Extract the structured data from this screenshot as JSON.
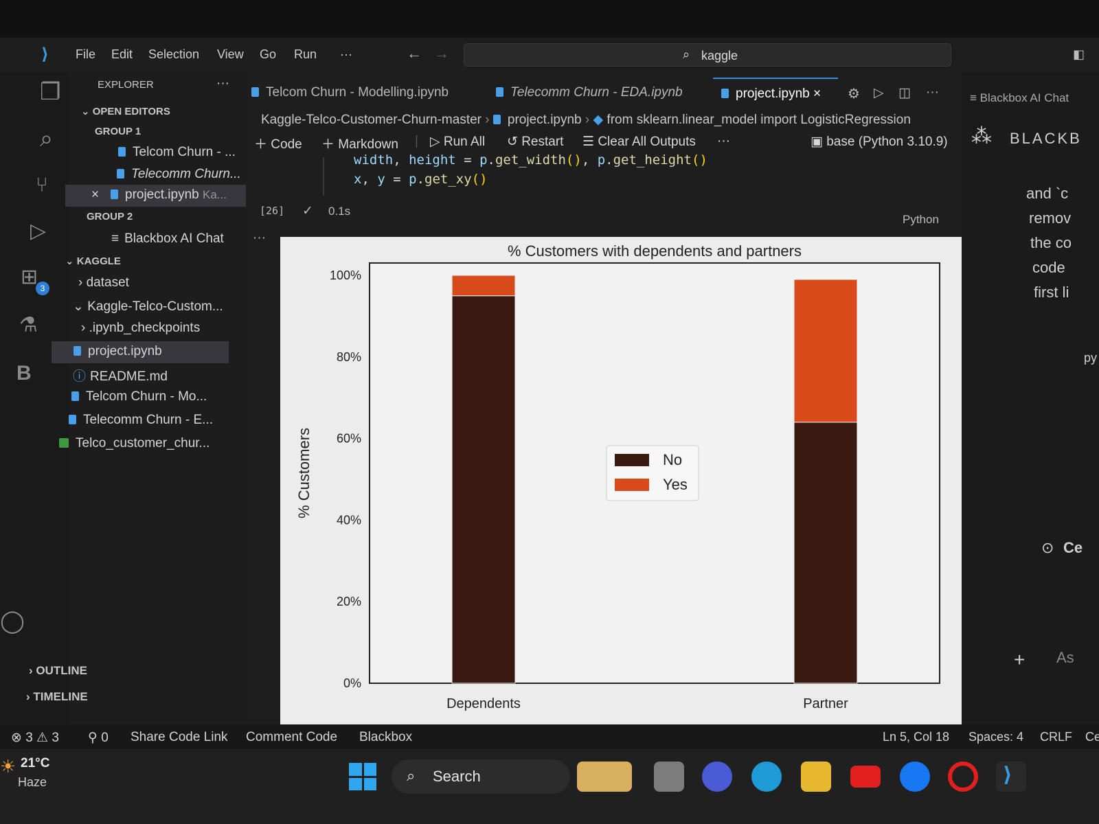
{
  "menubar": {
    "items": [
      "File",
      "Edit",
      "Selection",
      "View",
      "Go",
      "Run",
      "···"
    ],
    "search_text": "kaggle"
  },
  "sidebar": {
    "title": "EXPLORER",
    "more": "···",
    "open_editors": "OPEN EDITORS",
    "group1": "GROUP 1",
    "group1_items": [
      "Telcom Churn - ...",
      "Telecomm Churn...",
      "project.ipynb"
    ],
    "group1_item3_suffix": "Ka...",
    "group2": "GROUP 2",
    "group2_items": [
      "Blackbox AI Chat"
    ],
    "kaggle": "KAGGLE",
    "tree": [
      "dataset",
      "Kaggle-Telco-Custom...",
      ".ipynb_checkpoints",
      "project.ipynb",
      "README.md",
      "Telcom Churn - Mo...",
      "Telecomm Churn - E...",
      "Telco_customer_chur..."
    ],
    "outline": "OUTLINE",
    "timeline": "TIMELINE"
  },
  "activity": {
    "badge": "3"
  },
  "tabs": [
    {
      "label": "Telcom Churn - Modelling.ipynb"
    },
    {
      "label": "Telecomm Churn - EDA.ipynb"
    },
    {
      "label": "project.ipynb"
    }
  ],
  "tab_close": "×",
  "breadcrumb": [
    "Kaggle-Telco-Customer-Churn-master",
    "project.ipynb",
    "from sklearn.linear_model import LogisticRegression"
  ],
  "toolbar": {
    "code": "Code",
    "markdown": "Markdown",
    "run_all": "Run All",
    "restart": "Restart",
    "clear": "Clear All Outputs",
    "more": "···",
    "kernel": "base (Python 3.10.9)"
  },
  "cell": {
    "line1": {
      "v1": "width",
      "sep": ", ",
      "v2": "height",
      "eq": " = ",
      "obj": "p",
      "fn1": "get_width",
      "fn2": "get_height"
    },
    "line2": {
      "v1": "x",
      "sep": ", ",
      "v2": "y",
      "eq": " = ",
      "obj": "p",
      "fn": "get_xy"
    },
    "exec_count": "[26]",
    "time": "0.1s",
    "language": "Python",
    "output_more": "···"
  },
  "right_panel": {
    "tab": "Blackbox AI Chat",
    "brand": "BLACKB",
    "text_lines": [
      "and `c",
      "remov",
      "the co",
      "code",
      "first li"
    ],
    "py": "py",
    "ce": "Ce",
    "ask": "As"
  },
  "status": {
    "errors": "3",
    "warnings": "3",
    "ports": "0",
    "items": [
      "Share Code Link",
      "Comment Code",
      "Blackbox"
    ],
    "position": "Ln 5, Col 18",
    "spaces": "Spaces: 4",
    "eol": "CRLF",
    "extra": "Ce"
  },
  "taskbar": {
    "temp": "21°C",
    "weather": "Haze",
    "search": "Search"
  },
  "chart_data": {
    "type": "bar",
    "stacked": true,
    "title": "% Customers with dependents and partners",
    "ylabel": "% Customers",
    "xlabel": "",
    "categories": [
      "Dependents",
      "Partner"
    ],
    "series": [
      {
        "name": "No",
        "values": [
          95,
          64
        ],
        "color": "#3a1a10"
      },
      {
        "name": "Yes",
        "values": [
          5,
          35
        ],
        "color": "#d94a1a"
      }
    ],
    "yticks": [
      "0%",
      "20%",
      "40%",
      "60%",
      "80%",
      "100%"
    ],
    "ylim": [
      0,
      100
    ],
    "legend": "center"
  }
}
